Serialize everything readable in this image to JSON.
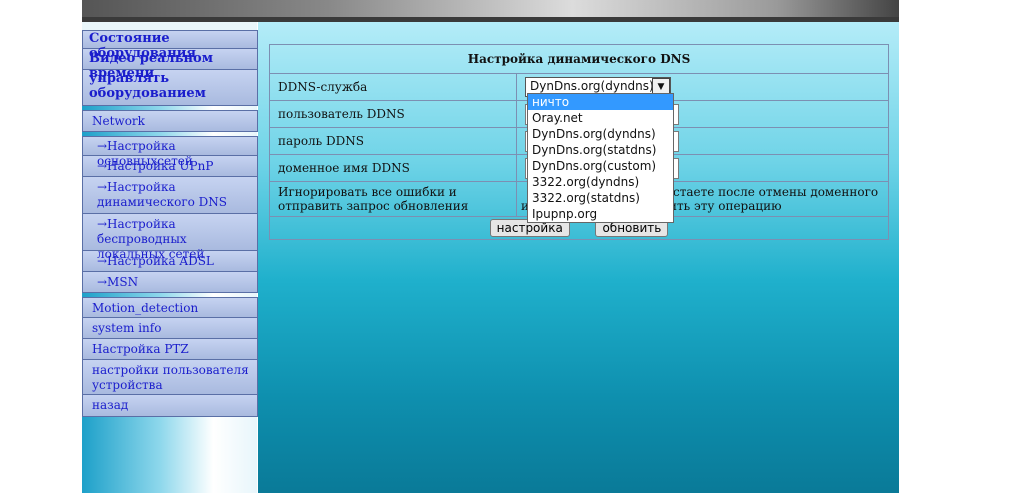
{
  "menu": {
    "status": "Состояние оборудования",
    "video": "Видео реальном времени",
    "manage": "управлять оборудованием",
    "network": "Network",
    "basic_net": "→Настройка основныхсетей",
    "upnp": "→Настройка UPnP",
    "ddns": "→Настройка динамического DNS",
    "wireless": "→Настройка беспроводных локальных сетей",
    "adsl": "→Настройка ADSL",
    "msn": "→MSN",
    "motion": "Motion_detection",
    "sysinfo": "system info",
    "ptz": "Настройка PTZ",
    "users": "настройки пользователя устройства",
    "back": "назад"
  },
  "form": {
    "title": "Настройка динамического DNS",
    "service_label": "DDNS-служба",
    "service_value": "DynDns.org(dyndns)",
    "user_label": "пользователь DDNS",
    "password_label": "пароль DDNS",
    "domain_label": "доменное имя DDNS",
    "ignore_label": "Игнорировать все ошибки и отправить запрос обновления",
    "ignore_hint_line1": "стаете после отмены доменного",
    "ignore_hint_line2": "ить эту операцию",
    "ignore_prefix_1": "",
    "ignore_prefix_2": "и",
    "submit": "настройка",
    "refresh": "обновить"
  },
  "dropdown": {
    "options": [
      "ничто",
      "Oray.net",
      "DynDns.org(dyndns)",
      "DynDns.org(statdns)",
      "DynDns.org(custom)",
      "3322.org(dyndns)",
      "3322.org(statdns)",
      "Ipupnp.org"
    ],
    "highlighted": "ничто"
  }
}
